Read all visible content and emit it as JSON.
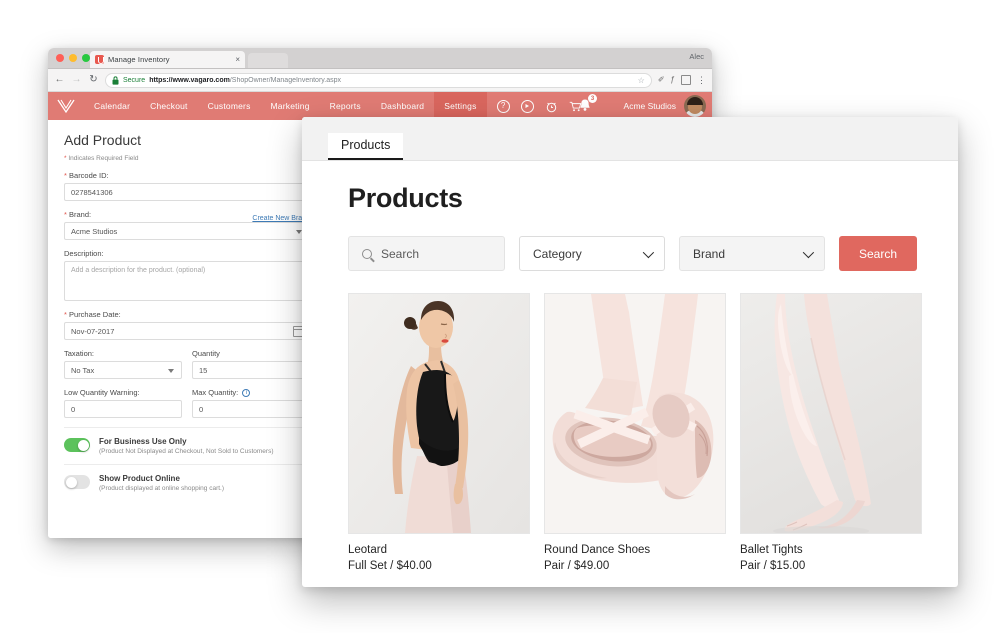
{
  "browser": {
    "tab_title": "Manage Inventory",
    "tab_close": "×",
    "profile_name": "Alec",
    "back": "←",
    "forward": "→",
    "reload": "↻",
    "secure_label": "Secure",
    "url_domain": "https://www.vagaro.com",
    "url_path": "/ShopOwner/ManageInventory.aspx",
    "star_icon": "☆",
    "kebab_icon": "⋮",
    "ext_pen_icon": "✐",
    "ext_script_icon": "ƒ",
    "ext_box_icon": "square-icon"
  },
  "app_nav": {
    "logo": "V",
    "items": [
      {
        "label": "Calendar",
        "active": false
      },
      {
        "label": "Checkout",
        "active": false
      },
      {
        "label": "Customers",
        "active": false
      },
      {
        "label": "Marketing",
        "active": false
      },
      {
        "label": "Reports",
        "active": false
      },
      {
        "label": "Dashboard",
        "active": false
      },
      {
        "label": "Settings",
        "active": true
      }
    ],
    "icons": [
      {
        "name": "help-icon",
        "glyph": "?"
      },
      {
        "name": "play-icon",
        "glyph": "▶"
      },
      {
        "name": "alarm-clock-icon",
        "glyph": "⏰"
      },
      {
        "name": "shopping-cart-icon",
        "glyph": "🛒"
      }
    ],
    "bell_icon": "🔔",
    "notification_count": "3",
    "shop_name": "Acme Studios",
    "accent_color": "#e07b74",
    "accent_active_color": "#d9665e"
  },
  "form": {
    "title": "Add Product",
    "required_note": "Indicates Required Field",
    "asterisk": "*",
    "barcode_label": "Barcode ID:",
    "barcode_value": "0278541306",
    "brand_label": "Brand:",
    "brand_value": "Acme Studios",
    "create_new_brand": "Create New Brand",
    "description_label": "Description:",
    "description_placeholder": "Add a description for the product. (optional)",
    "purchase_date_label": "Purchase Date:",
    "purchase_date_value": "Nov-07-2017",
    "taxation_label": "Taxation:",
    "taxation_value": "No Tax",
    "quantity_label": "Quantity",
    "quantity_value": "15",
    "low_qty_label": "Low Quantity Warning:",
    "low_qty_value": "0",
    "max_qty_label": "Max Quantity:",
    "max_qty_value": "0",
    "toggles": [
      {
        "title": "For Business Use Only",
        "subtitle": "(Product Not Displayed at Checkout, Not Sold to Customers)",
        "state": "on"
      },
      {
        "title": "Show Product Online",
        "subtitle": "(Product displayed at online shopping cart.)",
        "state": "off"
      }
    ],
    "toggle_on_color": "#5cc25c"
  },
  "products_window": {
    "tab_label": "Products",
    "heading": "Products",
    "search_placeholder": "Search",
    "category_label": "Category",
    "brand_label": "Brand",
    "search_button": "Search",
    "search_button_color": "#e0685f",
    "products": [
      {
        "name": "Leotard",
        "meta": "Full Set / $40.00",
        "image": "ballet-dancer-black-leotard-photo"
      },
      {
        "name": "Round Dance Shoes",
        "meta": "Pair / $49.00",
        "image": "pink-ballet-slippers-photo"
      },
      {
        "name": "Ballet Tights",
        "meta": "Pair / $15.00",
        "image": "pink-ballet-tights-legs-photo"
      }
    ]
  }
}
